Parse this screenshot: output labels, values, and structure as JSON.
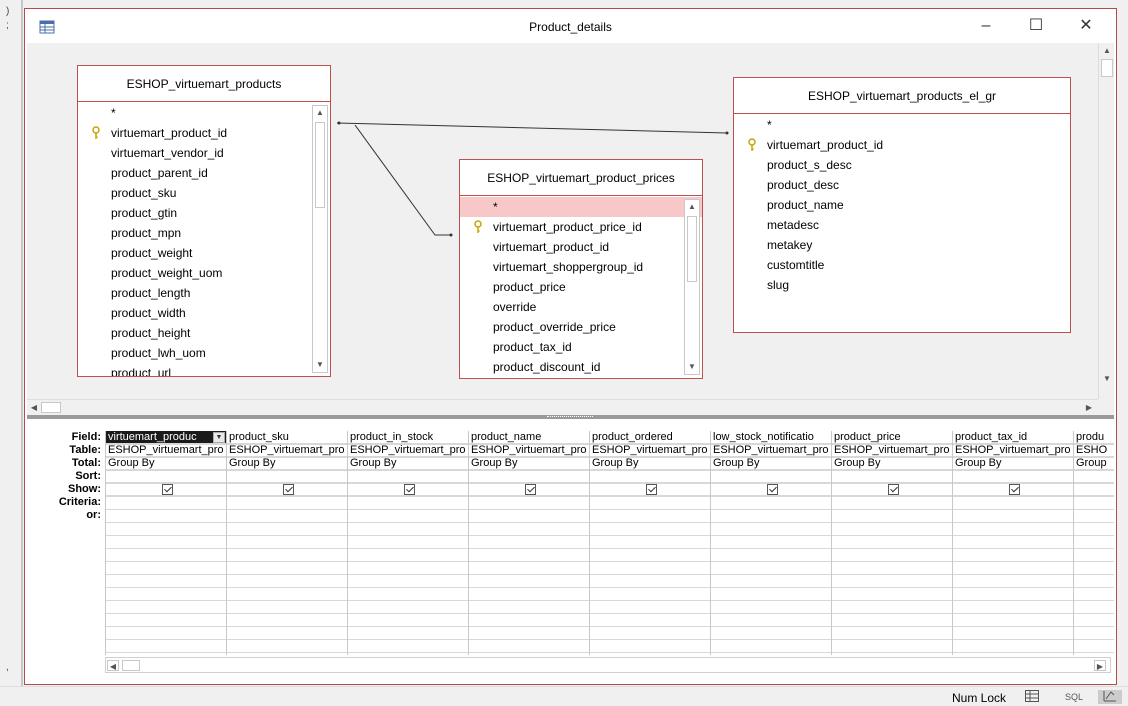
{
  "window": {
    "title": "Product_details",
    "minimize": "–",
    "maximize": "☐",
    "close": "✕"
  },
  "tables": [
    {
      "name": "ESHOP_virtuemart_products",
      "fields": [
        "*",
        "virtuemart_product_id",
        "virtuemart_vendor_id",
        "product_parent_id",
        "product_sku",
        "product_gtin",
        "product_mpn",
        "product_weight",
        "product_weight_uom",
        "product_length",
        "product_width",
        "product_height",
        "product_lwh_uom",
        "product_url"
      ],
      "key_field": "virtuemart_product_id"
    },
    {
      "name": "ESHOP_virtuemart_product_prices",
      "fields": [
        "*",
        "virtuemart_product_price_id",
        "virtuemart_product_id",
        "virtuemart_shoppergroup_id",
        "product_price",
        "override",
        "product_override_price",
        "product_tax_id",
        "product_discount_id"
      ],
      "key_field": "virtuemart_product_price_id",
      "selected_field": "*"
    },
    {
      "name": "ESHOP_virtuemart_products_el_gr",
      "fields": [
        "*",
        "virtuemart_product_id",
        "product_s_desc",
        "product_desc",
        "product_name",
        "metadesc",
        "metakey",
        "customtitle",
        "slug"
      ],
      "key_field": "virtuemart_product_id"
    }
  ],
  "grid": {
    "row_labels": [
      "Field:",
      "Table:",
      "Total:",
      "Sort:",
      "Show:",
      "Criteria:",
      "or:"
    ],
    "columns": [
      {
        "field": "virtuemart_produc",
        "table": "ESHOP_virtuemart_pro",
        "total": "Group By",
        "show": true
      },
      {
        "field": "product_sku",
        "table": "ESHOP_virtuemart_pro",
        "total": "Group By",
        "show": true
      },
      {
        "field": "product_in_stock",
        "table": "ESHOP_virtuemart_pro",
        "total": "Group By",
        "show": true
      },
      {
        "field": "product_name",
        "table": "ESHOP_virtuemart_pro",
        "total": "Group By",
        "show": true
      },
      {
        "field": "product_ordered",
        "table": "ESHOP_virtuemart_pro",
        "total": "Group By",
        "show": true
      },
      {
        "field": "low_stock_notificatio",
        "table": "ESHOP_virtuemart_pro",
        "total": "Group By",
        "show": true
      },
      {
        "field": "product_price",
        "table": "ESHOP_virtuemart_pro",
        "total": "Group By",
        "show": true
      },
      {
        "field": "product_tax_id",
        "table": "ESHOP_virtuemart_pro",
        "total": "Group By",
        "show": true
      },
      {
        "field": "produ",
        "table": "ESHO",
        "total": "Grouр",
        "show": false
      }
    ]
  },
  "status": {
    "num_lock": "Num Lock",
    "sql_label": "SQL"
  }
}
